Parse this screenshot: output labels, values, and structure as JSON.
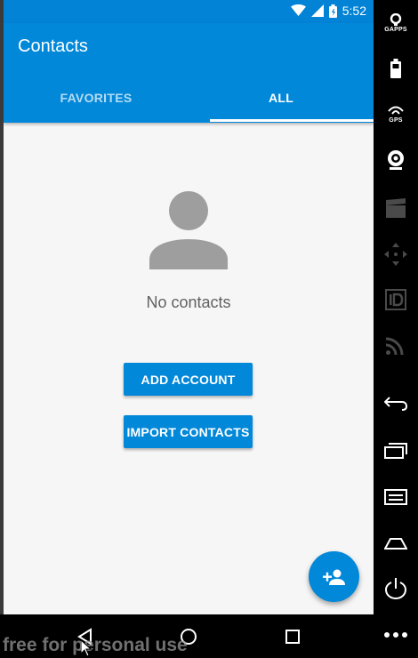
{
  "status_bar": {
    "time": "5:52",
    "icons": [
      "wifi-icon",
      "signal-icon",
      "battery-icon"
    ]
  },
  "app_bar": {
    "title": "Contacts"
  },
  "tabs": [
    {
      "label": "FAVORITES",
      "selected": false
    },
    {
      "label": "ALL",
      "selected": true
    }
  ],
  "empty_state": {
    "icon": "person-icon",
    "message": "No contacts",
    "add_account_label": "ADD ACCOUNT",
    "import_contacts_label": "IMPORT CONTACTS"
  },
  "fab": {
    "icon": "add-person-icon"
  },
  "nav_bar": {
    "icons": [
      "back-icon",
      "home-icon",
      "recents-icon"
    ]
  },
  "emulator_panel": {
    "items": [
      {
        "label": "GAPPS",
        "icon": "gapps-icon"
      },
      {
        "label": "",
        "icon": "battery-icon"
      },
      {
        "label": "GPS",
        "icon": "gps-icon"
      },
      {
        "label": "",
        "icon": "camera-icon"
      },
      {
        "label": "",
        "icon": "video-icon"
      },
      {
        "label": "",
        "icon": "dpad-icon"
      },
      {
        "label": "",
        "icon": "id-icon"
      },
      {
        "label": "",
        "icon": "cast-icon"
      },
      {
        "label": "",
        "icon": "back-icon"
      },
      {
        "label": "",
        "icon": "recent-apps-icon"
      },
      {
        "label": "",
        "icon": "menu-icon"
      },
      {
        "label": "",
        "icon": "home-icon"
      },
      {
        "label": "",
        "icon": "power-icon"
      },
      {
        "label": "",
        "icon": "more-icon"
      }
    ]
  },
  "watermark": "free for personal use",
  "colors": {
    "primary": "#0288d9",
    "status_bar": "#0283d6",
    "background": "#f6f6f6",
    "avatar": "#9e9e9e",
    "text_secondary": "#616161"
  }
}
